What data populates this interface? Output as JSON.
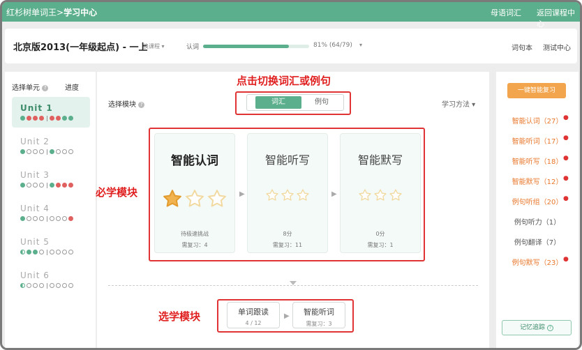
{
  "topbar": {
    "brand": "红杉树单词王",
    "sep": ">",
    "section": "学习中心",
    "nav": [
      "母语词汇",
      "返回课程中心"
    ]
  },
  "subbar": {
    "book": "北京版2013(一年级起点) - 一上",
    "switch": "换课程 ▾",
    "rec_label": "认词",
    "progress": 0.81,
    "progress_text": "81%  (64/79)",
    "caret": "▾",
    "right": [
      "词句本",
      "测试中心"
    ]
  },
  "sidebar": {
    "select_unit": "选择单元",
    "progress_label": "进度",
    "units": [
      {
        "name": "Unit 1",
        "dots": [
          "g",
          "r",
          "r",
          "r",
          "sep",
          "r",
          "r",
          "g",
          "g"
        ]
      },
      {
        "name": "Unit 2",
        "dots": [
          "g",
          "o",
          "o",
          "o",
          "sep",
          "g",
          "o",
          "o",
          "o"
        ]
      },
      {
        "name": "Unit 3",
        "dots": [
          "g",
          "o",
          "o",
          "o",
          "sep",
          "g",
          "r",
          "r",
          "r"
        ]
      },
      {
        "name": "Unit 4",
        "dots": [
          "g",
          "o",
          "o",
          "o",
          "sep",
          "o",
          "o",
          "o",
          "r"
        ]
      },
      {
        "name": "Unit 5",
        "dots": [
          "h",
          "g",
          "g",
          "o",
          "sep",
          "o",
          "o",
          "o",
          "o"
        ]
      },
      {
        "name": "Unit 6",
        "dots": [
          "h",
          "o",
          "o",
          "o",
          "sep",
          "o",
          "o",
          "o",
          "o"
        ]
      }
    ]
  },
  "main": {
    "module_label": "选择模块",
    "tabs": [
      "词汇",
      "例句"
    ],
    "method": "学习方法 ▾",
    "cards": [
      {
        "title": "智能认词",
        "line1": "待极速挑战",
        "line2": "需复习：4",
        "stars_filled": 1
      },
      {
        "title": "智能听写",
        "line1": "8分",
        "line2": "需复习：11",
        "stars_filled": 0
      },
      {
        "title": "智能默写",
        "line1": "0分",
        "line2": "需复习：1",
        "stars_filled": 0
      }
    ],
    "optional": [
      {
        "title": "单词跟读",
        "sub": "4 / 12"
      },
      {
        "title": "智能听词",
        "sub": "需复习：3"
      }
    ]
  },
  "annotations": {
    "top": "点击切换词汇或例句",
    "left": "必学模块",
    "bottom": "选学模块"
  },
  "right": {
    "button": "一键智能复习",
    "items": [
      {
        "label": "智能认词（27）",
        "star": true
      },
      {
        "label": "智能听词（17）",
        "star": true
      },
      {
        "label": "智能听写（18）",
        "star": true
      },
      {
        "label": "智能默写（12）",
        "star": true
      },
      {
        "label": "例句听组（20）",
        "star": true
      },
      {
        "label": "例句听力（1）",
        "star": false
      },
      {
        "label": "例句翻译（7）",
        "star": false
      },
      {
        "label": "例句默写（23）",
        "star": true
      }
    ],
    "memory": "记忆追踪"
  },
  "colors": {
    "brand": "#5caf8d",
    "accent": "#f2a54c",
    "alert": "#e03333"
  }
}
